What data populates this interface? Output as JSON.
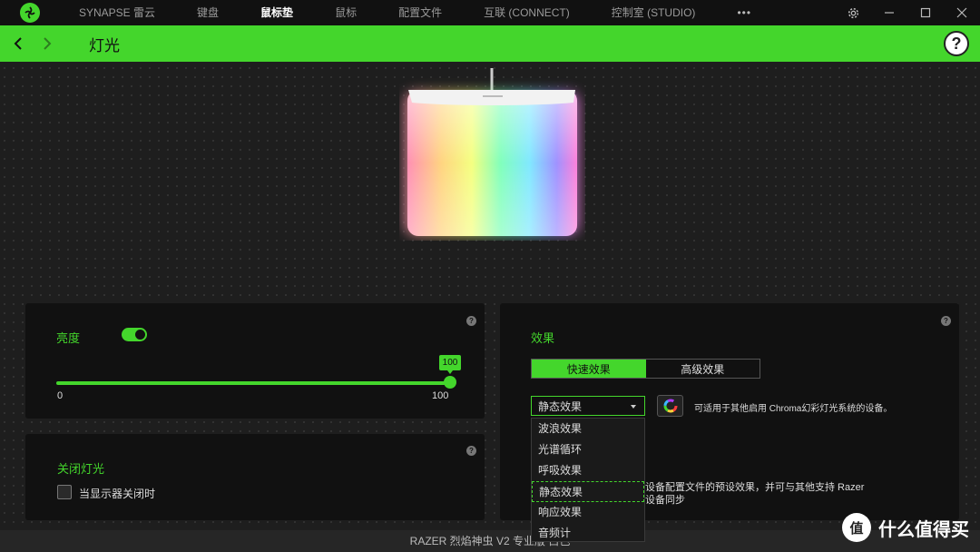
{
  "titlebar": {
    "nav": [
      {
        "label": "SYNAPSE 雷云"
      },
      {
        "label": "键盘"
      },
      {
        "label": "鼠标垫"
      },
      {
        "label": "鼠标"
      },
      {
        "label": "配置文件"
      },
      {
        "label": "互联 (CONNECT)"
      },
      {
        "label": "控制室 (STUDIO)"
      },
      {
        "label": "•••"
      }
    ],
    "active_tab": "鼠标垫"
  },
  "header": {
    "title": "灯光",
    "help_label": "?"
  },
  "brightness": {
    "label": "亮度",
    "toggle_on": true,
    "value": "100",
    "min_label": "0",
    "max_label": "100",
    "fraction": 1.0
  },
  "lights_off": {
    "label": "关闭灯光",
    "checkbox_label": "当显示器关闭时",
    "checked": false
  },
  "effects": {
    "label": "效果",
    "tabs": [
      {
        "label": "快速效果"
      },
      {
        "label": "高级效果"
      }
    ],
    "selected": "静态效果",
    "info": "可适用于其他启用 Chroma幻彩灯光系统的设备。",
    "desc_line1": "设备配置文件的预设效果，并可与其他支持 Razer",
    "desc_line2": "设备同步",
    "options": [
      {
        "label": "波浪效果"
      },
      {
        "label": "光谱循环"
      },
      {
        "label": "呼吸效果"
      },
      {
        "label": "静态效果"
      },
      {
        "label": "响应效果"
      },
      {
        "label": "音频计"
      }
    ]
  },
  "footer": {
    "device": "RAZER 烈焰神虫 V2 专业版 白色"
  },
  "watermark": {
    "text": "什么值得买",
    "glyph": "值"
  },
  "colors": {
    "accent": "#44d62c",
    "panel": "#111111",
    "background": "#1e1e1e"
  }
}
